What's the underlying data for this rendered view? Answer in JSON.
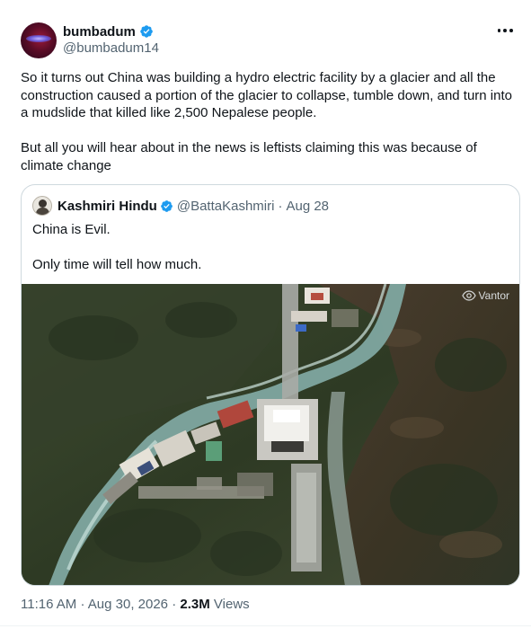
{
  "post": {
    "display_name": "bumbadum",
    "handle": "@bumbadum14",
    "more_icon": "more-horizontal-icon",
    "verified_icon": "verified-badge-icon",
    "text_para1": "So it turns out China was building a hydro electric facility by a glacier and all the construction caused a portion of the glacier to collapse, tumble down, and turn into a mudslide that killed like 2,500 Nepalese people.",
    "text_para2": "But all you will hear about in the news is leftists claiming this was because of climate change"
  },
  "quote": {
    "display_name": "Kashmiri Hindu",
    "handle": "@BattaKashmiri",
    "separator": "·",
    "date": "Aug 28",
    "line1": "China is Evil.",
    "line2": "Only time will tell how much.",
    "image_watermark": "Vantor"
  },
  "meta": {
    "time": "11:16 AM",
    "separator": "·",
    "date": "Aug 30, 2026",
    "views_count": "2.3M",
    "views_label": "Views"
  },
  "colors": {
    "text_primary": "#0f1419",
    "text_secondary": "#536471",
    "verified_blue": "#1d9bf0",
    "border": "#cfd9de"
  }
}
